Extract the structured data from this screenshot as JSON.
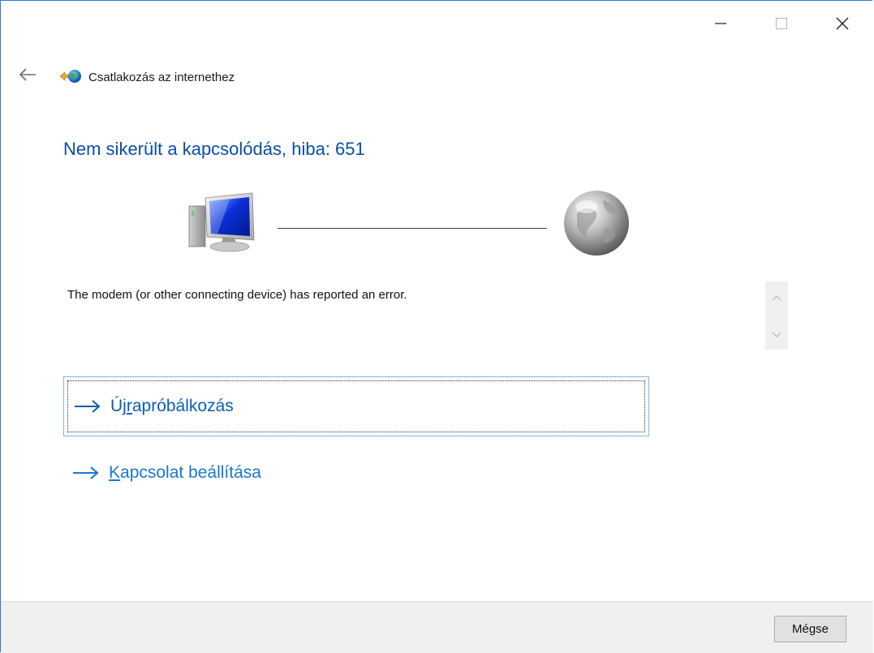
{
  "window": {
    "controls": {
      "minimize_icon": "minimize-icon",
      "maximize_icon": "maximize-icon",
      "close_icon": "close-icon"
    }
  },
  "nav": {
    "back_icon": "back-arrow-icon",
    "app_icon": "network-globe-icon",
    "title": "Csatlakozás az internethez"
  },
  "main": {
    "heading": "Nem sikerült a kapcsolódás, hiba: 651",
    "graphic": {
      "left_icon": "computer-icon",
      "right_icon": "globe-icon"
    },
    "message": "The modem (or other connecting device) has reported an error.",
    "links": [
      {
        "mnemonic_before": "Új",
        "mnemonic_char": "r",
        "mnemonic_after": "apróbálkozás",
        "icon": "arrow-right-icon"
      },
      {
        "mnemonic_before": "",
        "mnemonic_char": "K",
        "mnemonic_after": "apcsolat beállítása",
        "icon": "arrow-right-icon"
      }
    ]
  },
  "footer": {
    "cancel_label": "Mégse"
  },
  "colors": {
    "heading": "#0a4ea3",
    "link": "#0a5fb5",
    "window_border": "#2b7cd3",
    "footer_bg": "#f0f0f0"
  }
}
